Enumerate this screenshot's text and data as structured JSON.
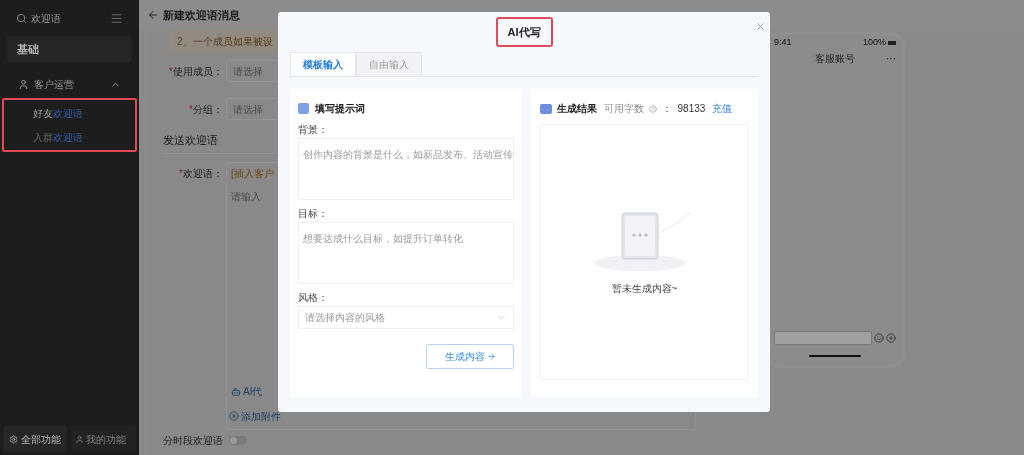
{
  "sidebar": {
    "search": {
      "value": "欢迎语"
    },
    "section": "基础",
    "group": {
      "label": "客户运营",
      "expanded": true,
      "highlighted": true,
      "children": [
        {
          "prefix": "好友",
          "match": "欢迎语",
          "selected": false
        },
        {
          "prefix": "入群",
          "match": "欢迎语",
          "selected": false
        }
      ]
    },
    "footer": [
      "全部功能",
      "我的功能"
    ]
  },
  "page": {
    "title": "新建欢迎语消息",
    "notice": "2、一个成员如果被设",
    "fields": [
      {
        "mark": "*",
        "label": "使用成员：",
        "placeholder": "请选择"
      },
      {
        "mark": "*",
        "label": "分组：",
        "placeholder": "请选择"
      }
    ],
    "section": "发送欢迎语",
    "welcome": {
      "mark": "*",
      "label": "欢迎语：",
      "insert_link": "[插入客户",
      "placeholder": "请输入",
      "ai_button": "AI代",
      "attach_button": "添加附件"
    },
    "timed": {
      "label": "分时段欢迎语",
      "on": false
    }
  },
  "phone": {
    "time": "9:41",
    "battery": "100%",
    "title": "客服账号",
    "more": "···"
  },
  "modal": {
    "title": "AI代写",
    "title_highlighted": true,
    "tabs": [
      {
        "label": "模板输入",
        "selected": true
      },
      {
        "label": "自由输入",
        "selected": false
      }
    ],
    "prompt_card": {
      "title": "填写提示词",
      "fields": [
        {
          "kind": "textarea",
          "label": "背景：",
          "placeholder": "创作内容的背景是什么，如新品发布、活动宣传"
        },
        {
          "kind": "textarea",
          "label": "目标：",
          "placeholder": "想要达成什么目标，如提升订单转化"
        },
        {
          "kind": "select",
          "label": "风格：",
          "placeholder": "请选择内容的风格"
        }
      ],
      "button": "生成内容"
    },
    "result_card": {
      "title": "生成结果",
      "quota_label": "可用字数",
      "quota_value": "：  98133",
      "recharge": "充值",
      "empty": "暂未生成内容~"
    }
  }
}
